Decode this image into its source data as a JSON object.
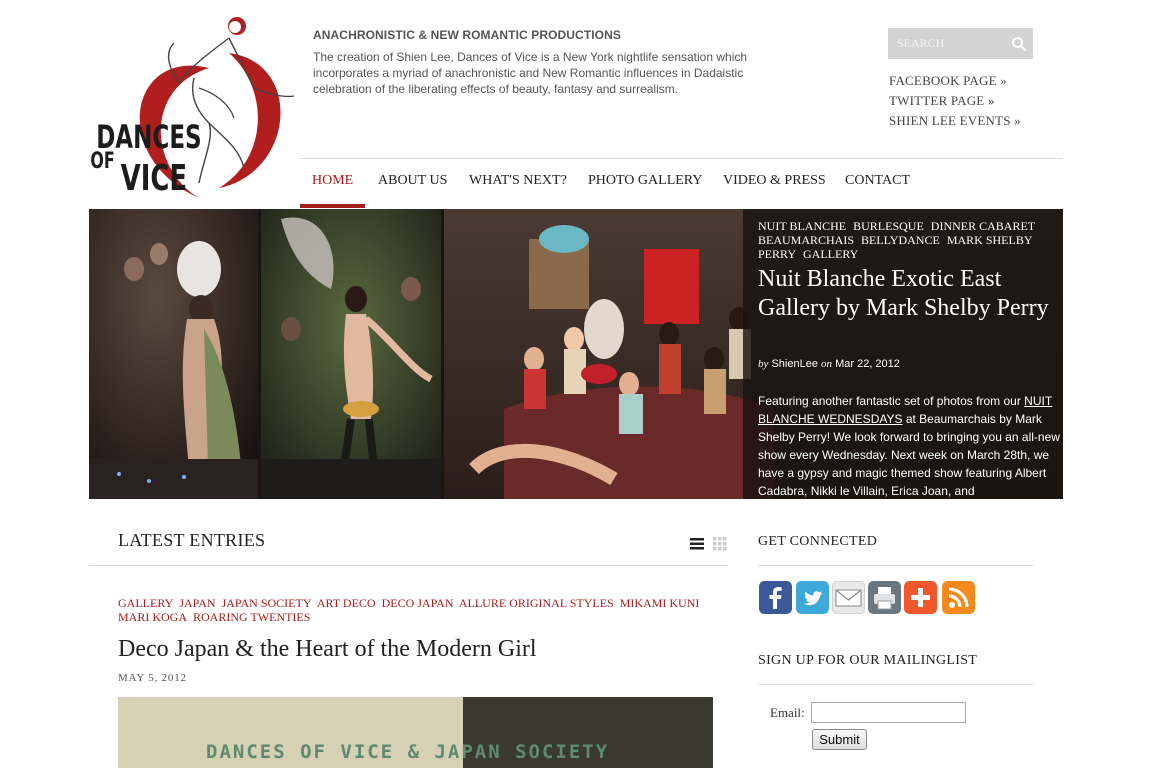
{
  "brand": {
    "logo_text_line1": "DANCES",
    "logo_text_line2": "OF VICE",
    "accent_color": "#a31d1d"
  },
  "tagline": {
    "title": "ANACHRONISTIC & NEW ROMANTIC PRODUCTIONS",
    "text": "The creation of Shien Lee, Dances of Vice is a New York nightlife sensation which incorporates a myriad of anachronistic and New Romantic influences in Dadaistic celebration of the liberating effects of beauty, fantasy and surrealism."
  },
  "search": {
    "placeholder": "SEARCH",
    "icon": "search-icon"
  },
  "social_links": [
    {
      "label": "FACEBOOK PAGE »"
    },
    {
      "label": "TWITTER PAGE »"
    },
    {
      "label": "SHIEN LEE EVENTS »"
    }
  ],
  "nav": {
    "items": [
      {
        "label": "HOME",
        "active": true
      },
      {
        "label": "ABOUT US",
        "active": false
      },
      {
        "label": "WHAT'S NEXT?",
        "active": false
      },
      {
        "label": "PHOTO GALLERY",
        "active": false
      },
      {
        "label": "VIDEO & PRESS",
        "active": false
      },
      {
        "label": "CONTACT",
        "active": false
      }
    ]
  },
  "featured": {
    "tags": [
      "NUIT BLANCHE",
      "BURLESQUE",
      "DINNER CABARET",
      "BEAUMARCHAIS",
      "BELLYDANCE",
      "MARK SHELBY PERRY",
      "GALLERY"
    ],
    "title": "Nuit Blanche Exotic East Gallery by Mark Shelby Perry",
    "meta_by": "by",
    "author": "ShienLee",
    "meta_on": "on",
    "date": "Mar 22, 2012",
    "excerpt_before": "Featuring another fantastic set of photos from our ",
    "excerpt_link": "NUIT BLANCHE WEDNESDAYS",
    "excerpt_after": " at Beaumarchais by Mark Shelby Perry! We look forward to bringing you an all-new show every Wednesday. Next week on March 28th, we have a gypsy and magic themed show featuring Albert Cadabra, Nikki le Villain, Erica Joan, and"
  },
  "latest": {
    "heading": "LATEST ENTRIES",
    "post": {
      "tags": [
        "GALLERY",
        "JAPAN",
        "JAPAN SOCIETY",
        "ART DECO",
        "DECO JAPAN",
        "ALLURE ORIGINAL STYLES",
        "MIKAMI KUNI",
        "MARI KOGA",
        "ROARING TWENTIES"
      ],
      "title": "Deco Japan & the Heart of the Modern Girl",
      "date": "MAY 5, 2012",
      "image_caption": "DANCES OF VICE & JAPAN SOCIETY"
    }
  },
  "sidebar": {
    "get_connected": "GET CONNECTED",
    "icons": [
      "facebook-icon",
      "twitter-icon",
      "email-icon",
      "print-icon",
      "share-plus-icon",
      "rss-icon"
    ],
    "mailing_heading": "SIGN UP FOR OUR MAILINGLIST",
    "email_label": "Email:",
    "email_value": "",
    "submit_label": "Submit"
  }
}
